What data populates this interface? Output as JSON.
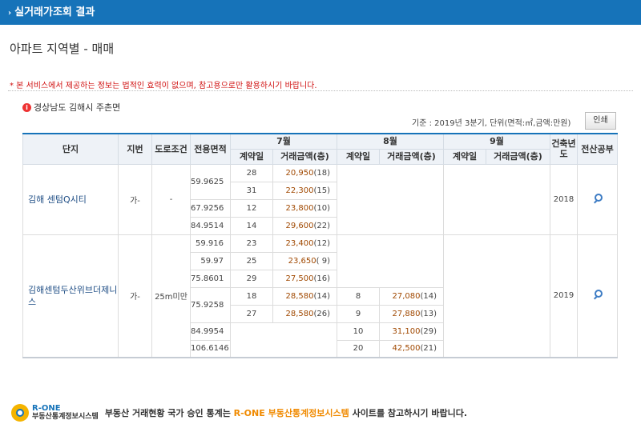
{
  "header": {
    "title": "실거래가조회 결과"
  },
  "page_title": "아파트 지역별 - 매매",
  "notice": "* 본 서비스에서 제공하는 정보는 법적인 효력이 없으며, 참고용으로만 활용하시기 바랍니다.",
  "region": "경상남도 김해시 주촌면",
  "criteria": "기준 : 2019년 3분기, 단위(면적:㎡,금액:만원)",
  "print_label": "인쇄",
  "table": {
    "headers": {
      "complex": "단지",
      "lot": "지번",
      "road": "도로조건",
      "area": "전용면적",
      "month1": "7월",
      "month2": "8월",
      "month3": "9월",
      "contract_day": "계약일",
      "amount": "거래금액(층)",
      "built_year": "건축년도",
      "register": "전산공부"
    },
    "complexes": [
      {
        "name": "김해 센텀Q시티",
        "lot": "가-",
        "road": "-",
        "built": "2018",
        "rows": [
          {
            "area": "59.9625",
            "m7_day": "28",
            "m7_price": "20,950",
            "m7_floor": "(18)",
            "m8_day": "",
            "m8_price": "",
            "m8_floor": ""
          },
          {
            "area": "",
            "m7_day": "31",
            "m7_price": "22,300",
            "m7_floor": "(15)",
            "m8_day": "",
            "m8_price": "",
            "m8_floor": ""
          },
          {
            "area": "67.9256",
            "m7_day": "12",
            "m7_price": "23,800",
            "m7_floor": "(10)",
            "m8_day": "",
            "m8_price": "",
            "m8_floor": ""
          },
          {
            "area": "84.9514",
            "m7_day": "14",
            "m7_price": "29,600",
            "m7_floor": "(22)",
            "m8_day": "",
            "m8_price": "",
            "m8_floor": ""
          }
        ]
      },
      {
        "name": "김해센텀두산위브더제니스",
        "lot": "가-",
        "road": "25m미만",
        "built": "2019",
        "rows": [
          {
            "area": "59.916",
            "m7_day": "23",
            "m7_price": "23,400",
            "m7_floor": "(12)",
            "m8_day": "",
            "m8_price": "",
            "m8_floor": ""
          },
          {
            "area": "59.97",
            "m7_day": "25",
            "m7_price": "23,650",
            "m7_floor": "( 9)",
            "m8_day": "",
            "m8_price": "",
            "m8_floor": ""
          },
          {
            "area": "75.8601",
            "m7_day": "29",
            "m7_price": "27,500",
            "m7_floor": "(16)",
            "m8_day": "",
            "m8_price": "",
            "m8_floor": ""
          },
          {
            "area": "75.9258",
            "m7_day": "18",
            "m7_price": "28,580",
            "m7_floor": "(14)",
            "m8_day": "8",
            "m8_price": "27,080",
            "m8_floor": "(14)"
          },
          {
            "area": "",
            "m7_day": "27",
            "m7_price": "28,580",
            "m7_floor": "(26)",
            "m8_day": "9",
            "m8_price": "27,880",
            "m8_floor": "(13)"
          },
          {
            "area": "84.9954",
            "m7_day": "",
            "m7_price": "",
            "m7_floor": "",
            "m8_day": "10",
            "m8_price": "31,100",
            "m8_floor": "(29)"
          },
          {
            "area": "106.6146",
            "m7_day": "",
            "m7_price": "",
            "m7_floor": "",
            "m8_day": "20",
            "m8_price": "42,500",
            "m8_floor": "(21)"
          }
        ]
      }
    ]
  },
  "footer": {
    "logo_top": "R-ONE",
    "logo_bottom": "부동산통계정보시스템",
    "msg_pre": "부동산 거래현황 국가 승인 통계는 ",
    "msg_highlight": "R-ONE 부동산통계정보시스템",
    "msg_post": " 사이트를 참고하시기 바랍니다."
  }
}
